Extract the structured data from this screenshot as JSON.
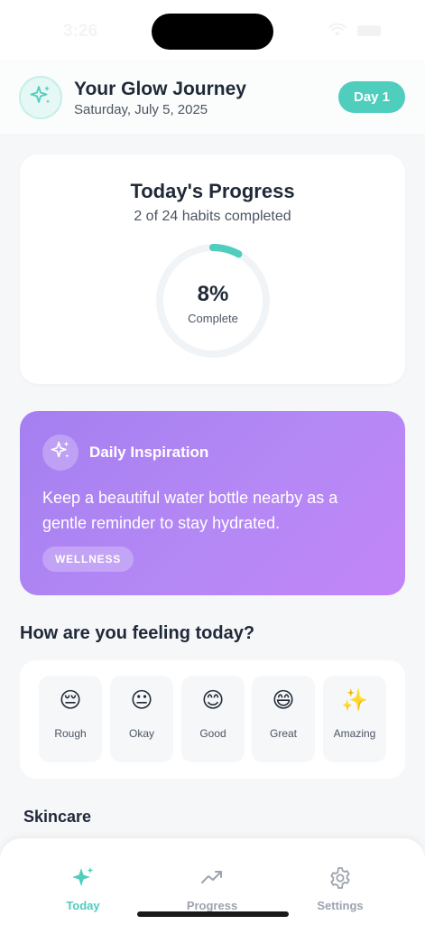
{
  "status_bar": {
    "time": "3:26"
  },
  "header": {
    "title": "Your Glow Journey",
    "date": "Saturday, July 5, 2025",
    "day_badge": "Day 1",
    "logo_icon": "sparkles-icon"
  },
  "progress": {
    "title": "Today's Progress",
    "subtitle": "2 of 24 habits completed",
    "percent_label": "8%",
    "complete_label": "Complete",
    "fraction": 0.08,
    "ring_color": "#4fcdbd",
    "track_color": "#f1f4f7"
  },
  "inspiration": {
    "icon": "sparkles-icon",
    "title": "Daily Inspiration",
    "text": "Keep a beautiful water bottle nearby as a gentle reminder to stay hydrated.",
    "tag": "WELLNESS"
  },
  "mood": {
    "heading": "How are you feeling today?",
    "options": [
      {
        "emoji": "😔",
        "label": "Rough"
      },
      {
        "emoji": "😐",
        "label": "Okay"
      },
      {
        "emoji": "😊",
        "label": "Good"
      },
      {
        "emoji": "😄",
        "label": "Great"
      },
      {
        "emoji": "✨",
        "label": "Amazing"
      }
    ]
  },
  "sections": {
    "skincare": "Skincare"
  },
  "tabs": [
    {
      "label": "Today",
      "icon": "sparkle-icon",
      "active": true
    },
    {
      "label": "Progress",
      "icon": "trending-up-icon",
      "active": false
    },
    {
      "label": "Settings",
      "icon": "gear-icon",
      "active": false
    }
  ],
  "colors": {
    "accent": "#4fcdbd",
    "inspiration_start": "#a57ff0",
    "inspiration_end": "#c285f8"
  }
}
